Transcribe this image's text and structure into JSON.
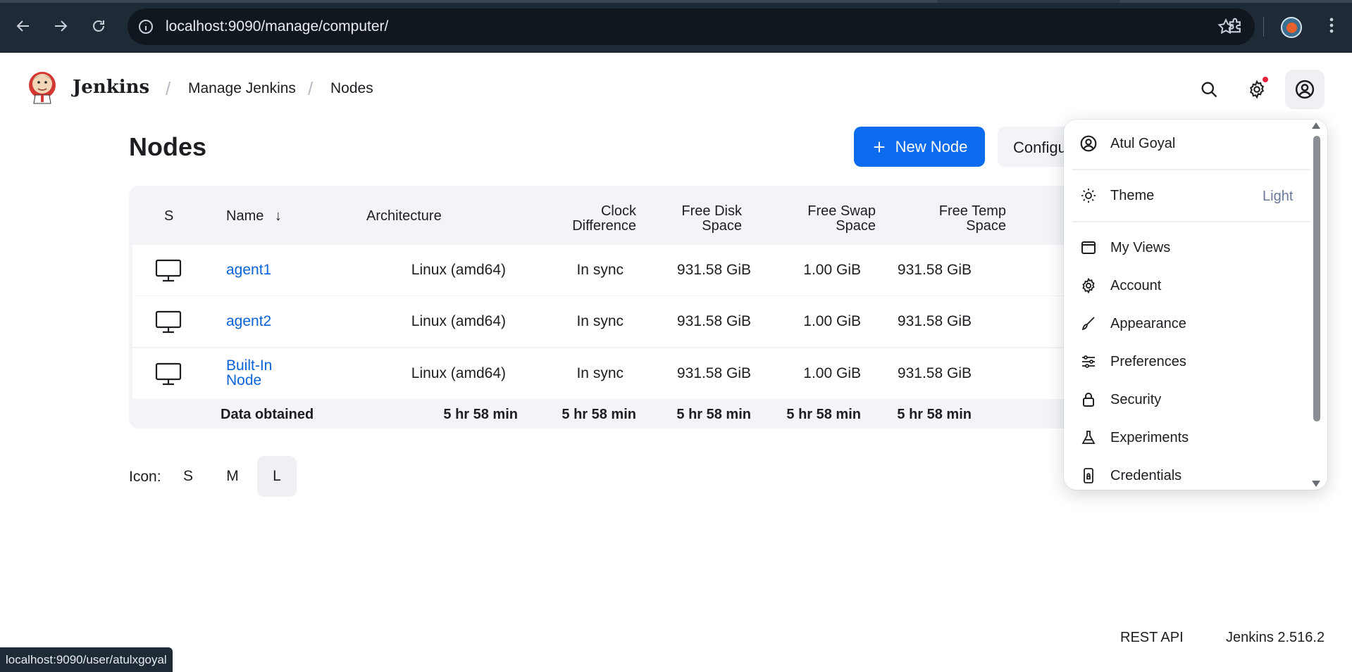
{
  "browser": {
    "url": "localhost:9090/manage/computer/",
    "status_url": "localhost:9090/user/atulxgoyal"
  },
  "header": {
    "brand": "Jenkins",
    "breadcrumbs": [
      "Manage Jenkins",
      "Nodes"
    ]
  },
  "page": {
    "title": "Nodes",
    "new_node_label": "New Node",
    "configure_label": "Configure Monitors"
  },
  "table": {
    "headers": {
      "status": "S",
      "name": "Name",
      "sort_indicator": "↓",
      "architecture": "Architecture",
      "clock_line1": "Clock",
      "clock_line2": "Difference",
      "disk_line1": "Free Disk",
      "disk_line2": "Space",
      "swap_line1": "Free Swap",
      "swap_line2": "Space",
      "temp_line1": "Free Temp",
      "temp_line2": "Space"
    },
    "rows": [
      {
        "name": "agent1",
        "architecture": "Linux (amd64)",
        "clock": "In sync",
        "disk": "931.58 GiB",
        "swap": "1.00 GiB",
        "temp": "931.58 GiB"
      },
      {
        "name": "agent2",
        "architecture": "Linux (amd64)",
        "clock": "In sync",
        "disk": "931.58 GiB",
        "swap": "1.00 GiB",
        "temp": "931.58 GiB"
      },
      {
        "name_line1": "Built-In",
        "name_line2": "Node",
        "architecture": "Linux (amd64)",
        "clock": "In sync",
        "disk": "931.58 GiB",
        "swap": "1.00 GiB",
        "temp": "931.58 GiB"
      }
    ],
    "footer": {
      "label": "Data obtained",
      "architecture": "5 hr 58 min",
      "clock": "5 hr 58 min",
      "disk": "5 hr 58 min",
      "swap": "5 hr 58 min",
      "temp": "5 hr 58 min"
    }
  },
  "icon_size": {
    "label": "Icon:",
    "options": [
      "S",
      "M",
      "L"
    ],
    "selected": "L"
  },
  "user_menu": {
    "user_name": "Atul Goyal",
    "theme_label": "Theme",
    "theme_value": "Light",
    "items": [
      "My Views",
      "Account",
      "Appearance",
      "Preferences",
      "Security",
      "Experiments",
      "Credentials"
    ]
  },
  "footer": {
    "rest_api": "REST API",
    "version": "Jenkins 2.516.2"
  },
  "colors": {
    "accent": "#0b6bef",
    "link": "#0b63d9",
    "chrome_bg": "#1f2a37",
    "notification_dot": "#e5223c"
  }
}
